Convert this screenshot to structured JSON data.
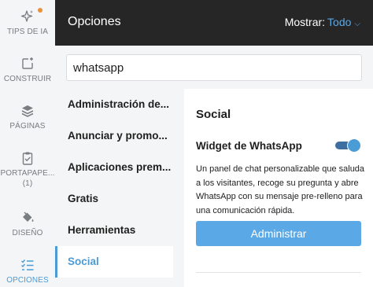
{
  "rail": {
    "items": [
      {
        "label": "TIPS DE IA",
        "icon": "sparkles-icon"
      },
      {
        "label": "CONSTRUIR",
        "icon": "add-square-icon"
      },
      {
        "label": "PÁGINAS",
        "icon": "layers-icon"
      },
      {
        "label_line1": "PORTAPAPE...",
        "label_line2": "(1)",
        "icon": "clipboard-check-icon"
      },
      {
        "label": "DISEÑO",
        "icon": "paint-bucket-icon"
      },
      {
        "label": "OPCIONES",
        "icon": "checklist-icon",
        "active": true
      }
    ]
  },
  "header": {
    "title": "Opciones",
    "filter_label": "Mostrar:",
    "filter_value": "Todo"
  },
  "search": {
    "value": "whatsapp"
  },
  "categories": [
    {
      "label": "Administración de..."
    },
    {
      "label": "Anunciar y promo..."
    },
    {
      "label": "Aplicaciones prem..."
    },
    {
      "label": "Gratis"
    },
    {
      "label": "Herramientas"
    },
    {
      "label": "Social",
      "active": true
    }
  ],
  "detail": {
    "section_title": "Social",
    "widget_title": "Widget de WhatsApp",
    "widget_enabled": true,
    "description": "Un panel de chat personalizable que saluda a los visitantes, recoge su pregunta y abre WhatsApp con su mensaje pre-relleno para una comunicación rápida.",
    "manage_label": "Administrar"
  },
  "colors": {
    "accent": "#4a9bd6",
    "header_bg": "#262626",
    "notification": "#e8913a"
  }
}
